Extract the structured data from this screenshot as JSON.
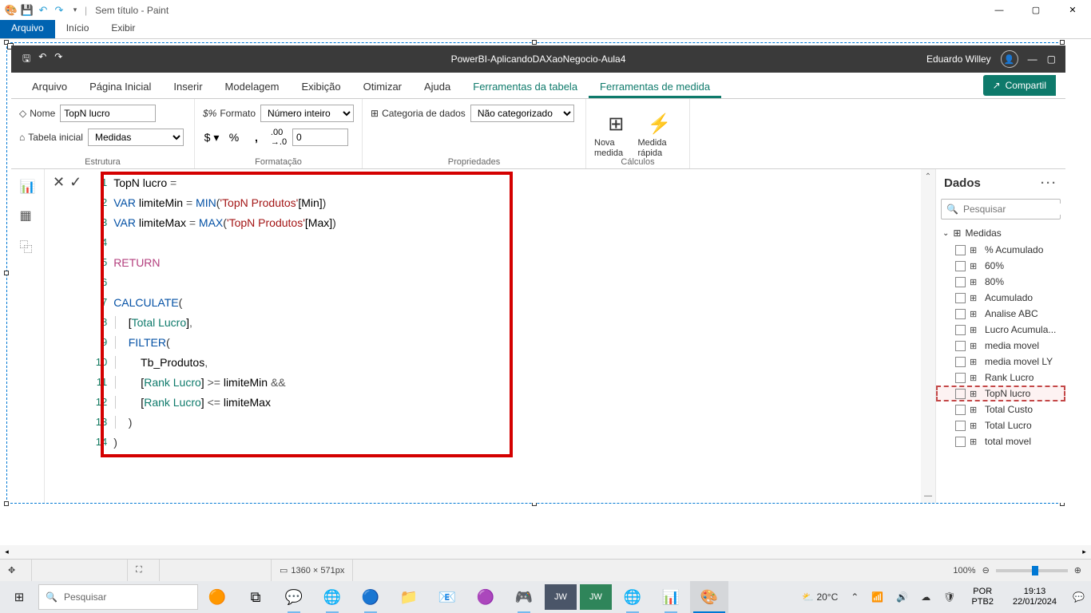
{
  "paint": {
    "title": "Sem título - Paint",
    "tabs": {
      "file": "Arquivo",
      "home": "Início",
      "view": "Exibir"
    },
    "status": {
      "dims": "1360 × 571px",
      "zoom": "100%"
    }
  },
  "pbi": {
    "title": "PowerBI-AplicandoDAXaoNegocio-Aula4",
    "user": "Eduardo Willey",
    "ribbon_tabs": {
      "arquivo": "Arquivo",
      "pagina": "Página Inicial",
      "inserir": "Inserir",
      "modelagem": "Modelagem",
      "exibicao": "Exibição",
      "otimizar": "Otimizar",
      "ajuda": "Ajuda",
      "ftab": "Ferramentas da tabela",
      "fmed": "Ferramentas de medida",
      "share": "Compartil"
    },
    "ribbon": {
      "nome_lbl": "Nome",
      "nome_val": "TopN lucro",
      "tabela_lbl": "Tabela inicial",
      "tabela_val": "Medidas",
      "estrutura": "Estrutura",
      "formato_lbl": "Formato",
      "formato_val": "Número inteiro",
      "decimals": "0",
      "formatacao": "Formatação",
      "categoria_lbl": "Categoria de dados",
      "categoria_val": "Não categorizado",
      "propriedades": "Propriedades",
      "nova_medida": "Nova medida",
      "medida_rapida": "Medida rápida",
      "calculos": "Cálculos"
    },
    "dados": {
      "header": "Dados",
      "search_ph": "Pesquisar",
      "table": "Medidas",
      "measures": [
        "% Acumulado",
        "60%",
        "80%",
        "Acumulado",
        "Analise ABC",
        "Lucro Acumula...",
        "media movel",
        "media movel LY",
        "Rank Lucro",
        "TopN lucro",
        "Total Custo",
        "Total Lucro",
        "total movel"
      ],
      "selected": "TopN lucro"
    },
    "code": {
      "lines": [
        "TopN lucro = ",
        "VAR limiteMin = MIN('TopN Produtos'[Min])",
        "VAR limiteMax = MAX('TopN Produtos'[Max])",
        "",
        "RETURN",
        "",
        "CALCULATE(",
        "    [Total Lucro],",
        "    FILTER(",
        "        Tb_Produtos,",
        "        [Rank Lucro] >= limiteMin &&",
        "        [Rank Lucro] <= limiteMax",
        "    )",
        ")"
      ]
    }
  },
  "taskbar": {
    "search_ph": "Pesquisar",
    "weather": "20°C",
    "lang1": "POR",
    "lang2": "PTB2",
    "time": "19:13",
    "date": "22/01/2024"
  }
}
